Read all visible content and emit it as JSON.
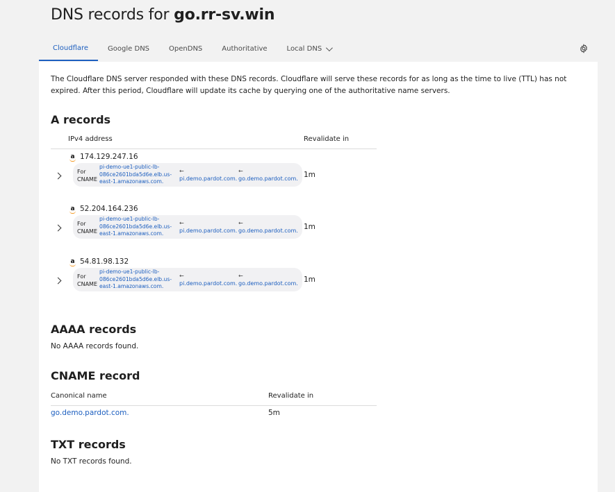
{
  "header": {
    "title_prefix": "DNS records for",
    "domain": "go.rr-sv.win"
  },
  "tabs": [
    {
      "label": "Cloudflare",
      "active": true
    },
    {
      "label": "Google DNS"
    },
    {
      "label": "OpenDNS"
    },
    {
      "label": "Authoritative"
    },
    {
      "label": "Local DNS"
    }
  ],
  "intro": "The Cloudflare DNS server responded with these DNS records. Cloudflare will serve these records for as long as the time to live (TTL) has not expired. After this period, Cloudflare will update its cache by querying one of the authoritative name servers.",
  "a_records": {
    "title": "A records",
    "headers": {
      "address": "IPv4 address",
      "revalidate": "Revalidate in"
    },
    "rows": [
      {
        "ip": "174.129.247.16",
        "for_label": "For CNAME",
        "chain": [
          "pi-demo-ue1-public-lb-086ce2601bda5d6e.elb.us-east-1.amazonaws.com.",
          "pi.demo.pardot.com.",
          "go.demo.pardot.com."
        ],
        "arrow": "←",
        "revalidate": "1m"
      },
      {
        "ip": "52.204.164.236",
        "for_label": "For CNAME",
        "chain": [
          "pi-demo-ue1-public-lb-086ce2601bda5d6e.elb.us-east-1.amazonaws.com.",
          "pi.demo.pardot.com.",
          "go.demo.pardot.com."
        ],
        "arrow": "←",
        "revalidate": "1m"
      },
      {
        "ip": "54.81.98.132",
        "for_label": "For CNAME",
        "chain": [
          "pi-demo-ue1-public-lb-086ce2601bda5d6e.elb.us-east-1.amazonaws.com.",
          "pi.demo.pardot.com.",
          "go.demo.pardot.com."
        ],
        "arrow": "←",
        "revalidate": "1m"
      }
    ]
  },
  "aaaa_records": {
    "title": "AAAA records",
    "empty": "No AAAA records found."
  },
  "cname_record": {
    "title": "CNAME record",
    "headers": {
      "name": "Canonical name",
      "revalidate": "Revalidate in"
    },
    "rows": [
      {
        "name": "go.demo.pardot.com.",
        "revalidate": "5m"
      }
    ]
  },
  "txt_records": {
    "title": "TXT records",
    "empty": "No TXT records found."
  },
  "icons": {
    "settings": "gear-icon",
    "amazon": "amazon-icon",
    "expand": "chevron-right-icon"
  },
  "colors": {
    "accent": "#1d5fbf",
    "pill_bg": "#f1f1f3",
    "amazon_orange": "#f59a23"
  }
}
